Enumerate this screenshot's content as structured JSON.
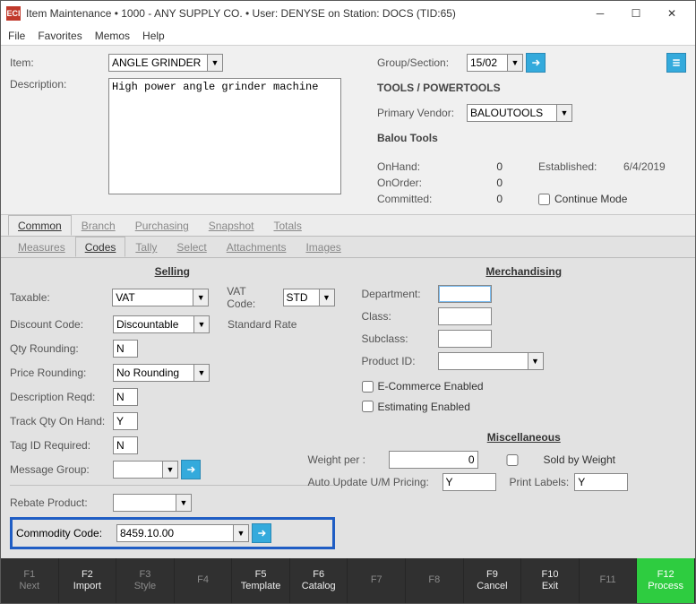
{
  "titlebar": {
    "title": "Item Maintenance  •  1000 - ANY SUPPLY CO.  •  User: DENYSE on Station: DOCS (TID:65)",
    "app_icon": "ECI"
  },
  "menu": {
    "file": "File",
    "favorites": "Favorites",
    "memos": "Memos",
    "help": "Help"
  },
  "top": {
    "item_lbl": "Item:",
    "item_value": "ANGLE GRINDER",
    "desc_lbl": "Description:",
    "desc_value": "High power angle grinder machine",
    "group_lbl": "Group/Section:",
    "group_value": "15/02",
    "group_path": "TOOLS / POWERTOOLS",
    "vendor_lbl": "Primary Vendor:",
    "vendor_value": "BALOUTOOLS",
    "vendor_name": "Balou Tools",
    "onhand_lbl": "OnHand:",
    "onhand_v": "0",
    "onorder_lbl": "OnOrder:",
    "onorder_v": "0",
    "committed_lbl": "Committed:",
    "committed_v": "0",
    "established_lbl": "Established:",
    "established_v": "6/4/2019",
    "continue_lbl": "Continue Mode"
  },
  "tabs1": {
    "common": "Common",
    "branch": "Branch",
    "purchasing": "Purchasing",
    "snapshot": "Snapshot",
    "totals": "Totals"
  },
  "tabs2": {
    "measures": "Measures",
    "codes": "Codes",
    "tally": "Tally",
    "select": "Select",
    "attachments": "Attachments",
    "images": "Images"
  },
  "selling": {
    "heading": "Selling",
    "taxable_lbl": "Taxable:",
    "taxable_v": "VAT",
    "vatcode_lbl": "VAT Code:",
    "vatcode_v": "STD",
    "vatcode_desc": "Standard Rate",
    "discount_lbl": "Discount Code:",
    "discount_v": "Discountable",
    "qty_lbl": "Qty Rounding:",
    "qty_v": "N",
    "price_lbl": "Price Rounding:",
    "price_v": "No Rounding",
    "desc_lbl": "Description Reqd:",
    "desc_v": "N",
    "track_lbl": "Track Qty On Hand:",
    "track_v": "Y",
    "tag_lbl": "Tag ID Required:",
    "tag_v": "N",
    "msg_lbl": "Message Group:",
    "msg_v": "",
    "rebate_lbl": "Rebate Product:",
    "rebate_v": "",
    "commodity_lbl": "Commodity Code:",
    "commodity_v": "8459.10.00"
  },
  "merch": {
    "heading": "Merchandising",
    "dept": "Department:",
    "class": "Class:",
    "subclass": "Subclass:",
    "prodid": "Product ID:",
    "ecom": "E-Commerce Enabled",
    "est": "Estimating Enabled",
    "misc_heading": "Miscellaneous",
    "weight_lbl": "Weight per :",
    "weight_v": "0",
    "sold_lbl": "Sold by Weight",
    "auto_lbl": "Auto Update U/M Pricing:",
    "auto_v": "Y",
    "print_lbl": "Print Labels:",
    "print_v": "Y"
  },
  "fn": {
    "f1": "F1",
    "f1t": "Next",
    "f2": "F2",
    "f2t": "Import",
    "f3": "F3",
    "f3t": "Style",
    "f4": "F4",
    "f4t": "",
    "f5": "F5",
    "f5t": "Template",
    "f6": "F6",
    "f6t": "Catalog",
    "f7": "F7",
    "f7t": "",
    "f8": "F8",
    "f8t": "",
    "f9": "F9",
    "f9t": "Cancel",
    "f10": "F10",
    "f10t": "Exit",
    "f11": "F11",
    "f11t": "",
    "f12": "F12",
    "f12t": "Process"
  }
}
